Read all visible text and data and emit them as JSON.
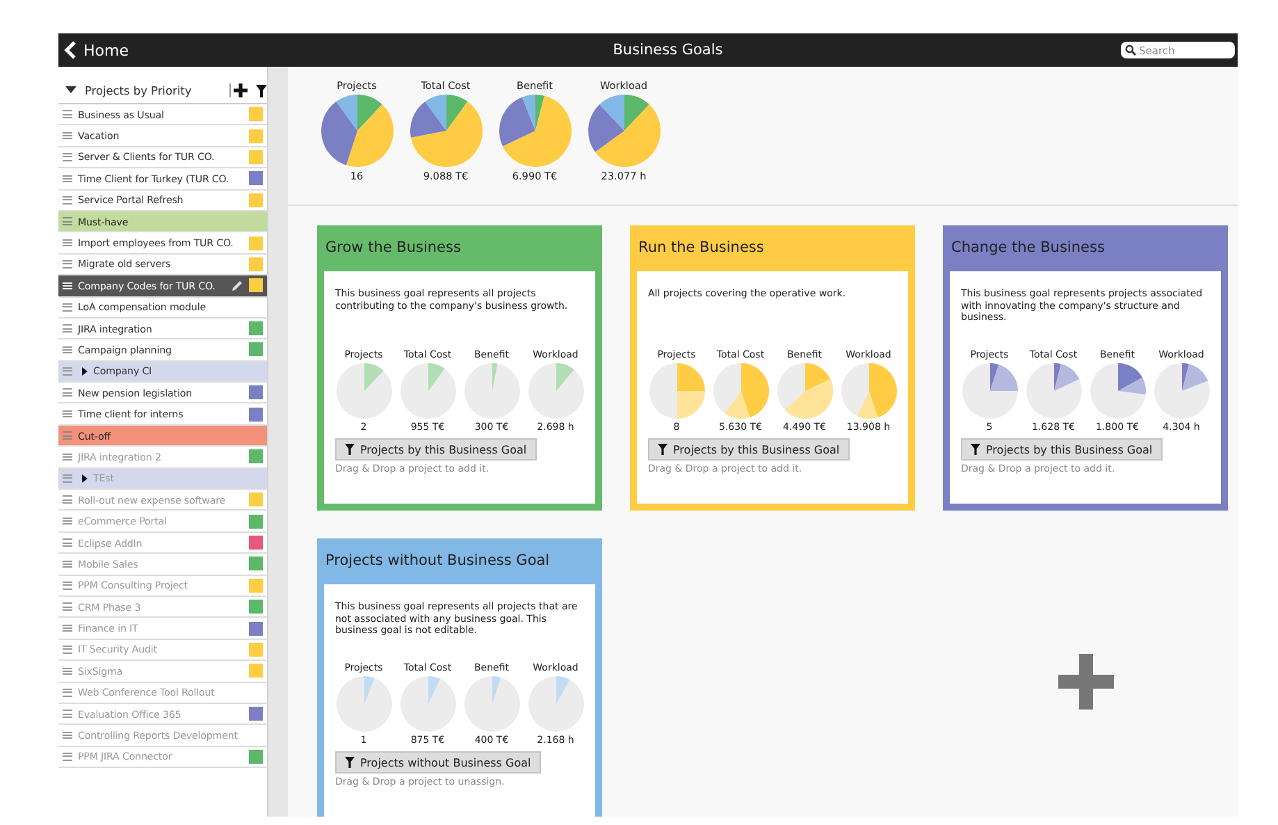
{
  "topbar": {
    "back_label": "Home",
    "title": "Business Goals",
    "search": {
      "placeholder": "Search"
    }
  },
  "sidebar": {
    "title": "Projects by Priority",
    "items": [
      {
        "kind": "item",
        "label": "Business as Usual",
        "color": "#ffcc44",
        "selected": false,
        "disabled": false
      },
      {
        "kind": "item",
        "label": "Vacation",
        "color": "#ffcc44",
        "selected": false,
        "disabled": false
      },
      {
        "kind": "item",
        "label": "Server & Clients for TUR CO.",
        "color": "#ffcc44",
        "selected": false,
        "disabled": false
      },
      {
        "kind": "item",
        "label": "Time Client for Turkey (TUR CO.",
        "color": "#7b7fc4",
        "selected": false,
        "disabled": false
      },
      {
        "kind": "item",
        "label": "Service Portal Refresh",
        "color": "#ffcc44",
        "selected": false,
        "disabled": false
      },
      {
        "kind": "group",
        "label": "Must-have",
        "color": "#c3dc9e"
      },
      {
        "kind": "item",
        "label": "Import employees from TUR CO.",
        "color": "#ffcc44",
        "selected": false,
        "disabled": false
      },
      {
        "kind": "item",
        "label": "Migrate old servers",
        "color": "#ffcc44",
        "selected": false,
        "disabled": false
      },
      {
        "kind": "item",
        "label": "Company Codes for TUR CO.",
        "color": "#ffcc44",
        "selected": true,
        "disabled": false
      },
      {
        "kind": "item",
        "label": "LoA compensation module",
        "selected": false,
        "disabled": false
      },
      {
        "kind": "item",
        "label": "JIRA integration",
        "color": "#5cb86a",
        "selected": false,
        "disabled": false
      },
      {
        "kind": "item",
        "label": "Campaign planning",
        "color": "#5cb86a",
        "selected": false,
        "disabled": false
      },
      {
        "kind": "folder",
        "label": "Company CI",
        "expanded": false,
        "disabled": false
      },
      {
        "kind": "item",
        "label": "New pension legislation",
        "color": "#7b7fc4",
        "selected": false,
        "disabled": false
      },
      {
        "kind": "item",
        "label": "Time client for interns",
        "color": "#7b7fc4",
        "selected": false,
        "disabled": false
      },
      {
        "kind": "group",
        "label": "Cut-off",
        "color": "#f4917a"
      },
      {
        "kind": "item",
        "label": "JIRA integration 2",
        "color": "#5cb86a",
        "selected": false,
        "disabled": true
      },
      {
        "kind": "folder",
        "label": "TEst",
        "expanded": false,
        "disabled": true
      },
      {
        "kind": "item",
        "label": "Roll-out new expense software",
        "color": "#ffcc44",
        "selected": false,
        "disabled": true
      },
      {
        "kind": "item",
        "label": "eCommerce Portal",
        "color": "#5cb86a",
        "selected": false,
        "disabled": true
      },
      {
        "kind": "item",
        "label": "Eclipse AddIn",
        "color": "#e8587a",
        "selected": false,
        "disabled": true
      },
      {
        "kind": "item",
        "label": "Mobile Sales",
        "color": "#5cb86a",
        "selected": false,
        "disabled": true
      },
      {
        "kind": "item",
        "label": "PPM Consulting Project",
        "color": "#ffcc44",
        "selected": false,
        "disabled": true
      },
      {
        "kind": "item",
        "label": "CRM Phase 3",
        "color": "#5cb86a",
        "selected": false,
        "disabled": true
      },
      {
        "kind": "item",
        "label": "Finance in IT",
        "color": "#7b7fc4",
        "selected": false,
        "disabled": true
      },
      {
        "kind": "item",
        "label": "IT Security Audit",
        "color": "#ffcc44",
        "selected": false,
        "disabled": true
      },
      {
        "kind": "item",
        "label": "SixSigma",
        "color": "#ffcc44",
        "selected": false,
        "disabled": true
      },
      {
        "kind": "item",
        "label": "Web Conference Tool Rollout",
        "selected": false,
        "disabled": true
      },
      {
        "kind": "item",
        "label": "Evaluation Office 365",
        "color": "#7b7fc4",
        "selected": false,
        "disabled": true
      },
      {
        "kind": "item",
        "label": "Controlling Reports Development",
        "selected": false,
        "disabled": true
      },
      {
        "kind": "item",
        "label": "PPM JIRA Connector",
        "color": "#5cb86a",
        "selected": false,
        "disabled": true
      }
    ]
  },
  "summary": [
    {
      "label": "Projects",
      "value": "16"
    },
    {
      "label": "Total Cost",
      "value": "9.088 T€"
    },
    {
      "label": "Benefit",
      "value": "6.990 T€"
    },
    {
      "label": "Workload",
      "value": "23.077 h"
    }
  ],
  "goals": [
    {
      "title": "Grow the Business",
      "color": "#66bb6a",
      "description": "This business goal represents all projects contributing to the company's business growth.",
      "metrics": [
        {
          "label": "Projects",
          "value": "2"
        },
        {
          "label": "Total Cost",
          "value": "955 T€"
        },
        {
          "label": "Benefit",
          "value": "300 T€"
        },
        {
          "label": "Workload",
          "value": "2.698 h"
        }
      ],
      "button": "Projects by this Business Goal",
      "hint": "Drag & Drop a project to add it."
    },
    {
      "title": "Run the Business",
      "color": "#ffcc44",
      "description": "All projects covering the operative work.",
      "metrics": [
        {
          "label": "Projects",
          "value": "8"
        },
        {
          "label": "Total Cost",
          "value": "5.630 T€"
        },
        {
          "label": "Benefit",
          "value": "4.490 T€"
        },
        {
          "label": "Workload",
          "value": "13.908 h"
        }
      ],
      "button": "Projects by this Business Goal",
      "hint": "Drag & Drop a project to add it."
    },
    {
      "title": "Change the Business",
      "color": "#7b7fc4",
      "description": "This business goal represents projects associated with innovating the company's structure and business.",
      "metrics": [
        {
          "label": "Projects",
          "value": "5"
        },
        {
          "label": "Total Cost",
          "value": "1.628 T€"
        },
        {
          "label": "Benefit",
          "value": "1.800 T€"
        },
        {
          "label": "Workload",
          "value": "4.304 h"
        }
      ],
      "button": "Projects by this Business Goal",
      "hint": "Drag & Drop a project to add it."
    },
    {
      "title": "Projects without Business Goal",
      "color": "#82b8e6",
      "description": "This business goal represents all projects that are not associated with any business goal. This business goal is not editable.",
      "metrics": [
        {
          "label": "Projects",
          "value": "1"
        },
        {
          "label": "Total Cost",
          "value": "875 T€"
        },
        {
          "label": "Benefit",
          "value": "400 T€"
        },
        {
          "label": "Workload",
          "value": "2.168 h"
        }
      ],
      "button": "Projects without Business Goal",
      "hint": "Drag & Drop a project to unassign."
    }
  ]
}
